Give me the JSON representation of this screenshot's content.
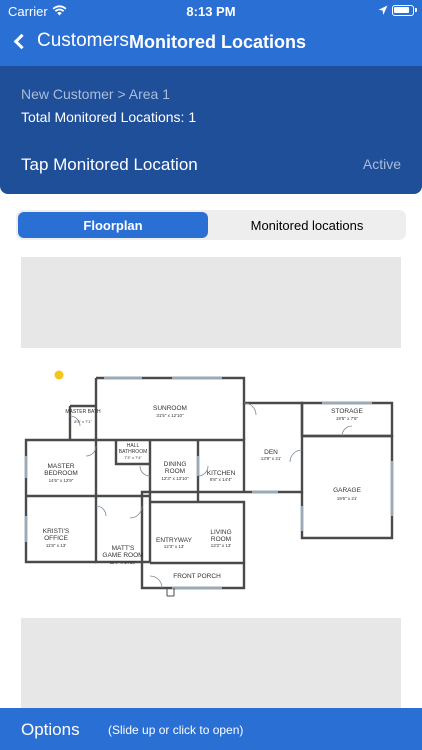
{
  "status": {
    "carrier": "Carrier",
    "time": "8:13 PM",
    "battery_level": 0.9
  },
  "nav": {
    "back_label": "Customers",
    "title": "Monitored Locations"
  },
  "info": {
    "path": "New Customer > Area 1",
    "total": "Total Monitored Locations: 1",
    "tap": "Tap Monitored Location",
    "status": "Active"
  },
  "tabs": {
    "floorplan": "Floorplan",
    "monitored": "Monitored locations"
  },
  "floorplan": {
    "rooms": {
      "master_bath": "MASTER BATH",
      "master_bath_dim": "8'3\" x 7'1\"",
      "sunroom": "SUNROOM",
      "sunroom_dim": "31'5\" x 12'10\"",
      "storage": "STORAGE",
      "storage_dim": "19'5\" x 7'6\"",
      "master_bedroom_1": "MASTER",
      "master_bedroom_2": "BEDROOM",
      "master_bedroom_dim": "14'6\" x 12'9\"",
      "hall_bathroom_1": "HALL",
      "hall_bathroom_2": "BATHROOM",
      "hall_bathroom_dim": "7'3\" x 7'4\"",
      "dining_room_1": "DINING",
      "dining_room_2": "ROOM",
      "dining_room_dim": "12'3\" x 13'10\"",
      "kitchen": "KITCHEN",
      "kitchen_dim": "8'8\" x 14'4\"",
      "den": "DEN",
      "den_dim": "13'9\" x 21'",
      "garage": "GARAGE",
      "garage_dim": "19'6\" x 21'",
      "kristis_office_1": "KRISTI'S",
      "kristis_office_2": "OFFICE",
      "kristis_office_dim": "11'8\" x 13'",
      "matts_game_room_1": "MATT'S",
      "matts_game_room_2": "GAME ROOM",
      "matts_game_room_dim": "11'4\" x 14'10\"",
      "entryway": "ENTRYWAY",
      "entryway_dim": "12'3\" x 13'",
      "living_room_1": "LIVING",
      "living_room_2": "ROOM",
      "living_room_dim": "13'2\" x 13'",
      "front_porch": "FRONT PORCH"
    },
    "marker_color": "#f5c518"
  },
  "options": {
    "label": "Options",
    "hint": "(Slide up or click to open)"
  },
  "colors": {
    "primary": "#2a6fd3",
    "card": "#1f4f99"
  }
}
